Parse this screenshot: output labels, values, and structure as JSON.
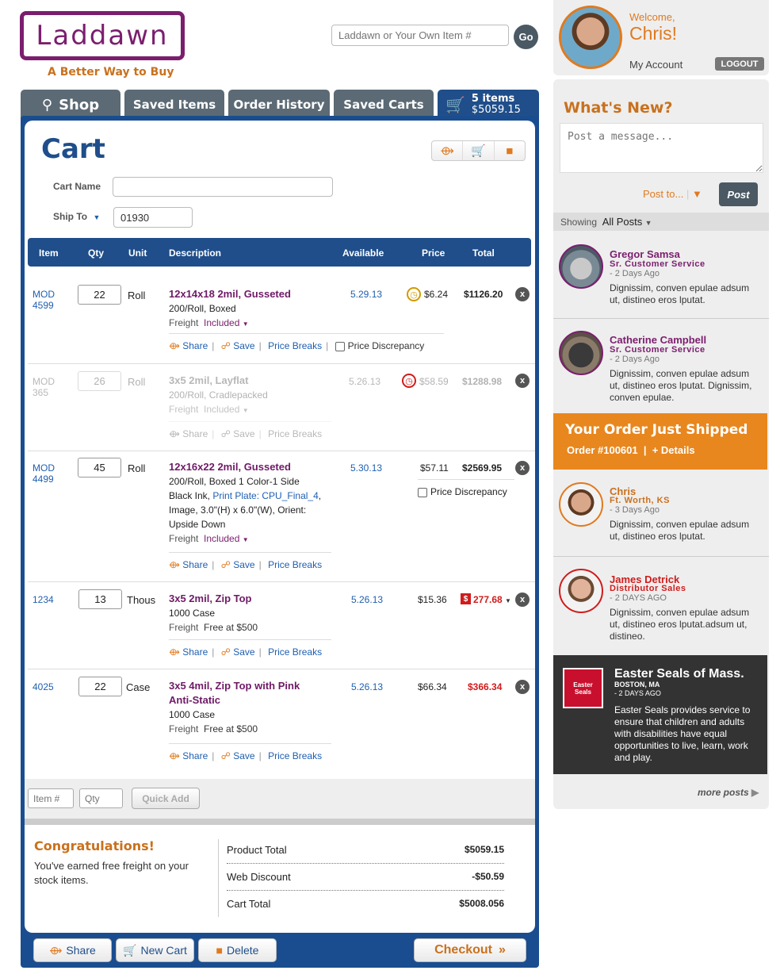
{
  "header": {
    "logo": "Laddawn",
    "tagline": "A Better Way to Buy",
    "search_placeholder": "Laddawn or Your Own Item #",
    "go_label": "Go"
  },
  "tabs": {
    "shop": "Shop",
    "saved_items": "Saved Items",
    "order_history": "Order History",
    "saved_carts": "Saved Carts",
    "cart_items": "5 items",
    "cart_total": "$5059.15"
  },
  "cart": {
    "title": "Cart",
    "cart_name_label": "Cart Name",
    "cart_name_value": "",
    "ship_to_label": "Ship To",
    "ship_to_value": "01930",
    "columns": {
      "item": "Item",
      "qty": "Qty",
      "unit": "Unit",
      "description": "Description",
      "available": "Available",
      "price": "Price",
      "total": "Total"
    },
    "freight_label": "Freight",
    "share": "Share",
    "save": "Save",
    "price_breaks": "Price Breaks",
    "price_discrepancy": "Price Discrepancy",
    "rows": [
      {
        "item1": "MOD",
        "item2": "4599",
        "qty": "22",
        "unit": "Roll",
        "title": "12x14x18 2mil, Gusseted",
        "line1": "200/Roll, Boxed",
        "freight": "Included",
        "available": "5.29.13",
        "price": "$6.24",
        "total": "$1126.20"
      },
      {
        "item1": "MOD",
        "item2": "365",
        "qty": "26",
        "unit": "Roll",
        "title": "3x5 2mil, Layflat",
        "line1": "200/Roll, Cradlepacked",
        "freight": "Included",
        "available": "5.26.13",
        "price": "$58.59",
        "total": "$1288.98"
      },
      {
        "item1": "MOD",
        "item2": "4499",
        "qty": "45",
        "unit": "Roll",
        "title": "12x16x22 2mil, Gusseted",
        "line1": "200/Roll, Boxed  1 Color-1 Side",
        "line2a": "Black Ink, ",
        "line2link": "Print Plate: CPU_Final_4",
        "line2b": ",",
        "line3": "Image, 3.0\"(H) x 6.0\"(W), Orient:",
        "line4": "Upside Down",
        "freight": "Included",
        "available": "5.30.13",
        "price": "$57.11",
        "total": "$2569.95"
      },
      {
        "item1": "1234",
        "qty": "13",
        "unit": "Thous",
        "title": "3x5 2mil, Zip Top",
        "line1": "1000 Case",
        "freight": "Free at $500",
        "available": "5.26.13",
        "price": "$15.36",
        "total": "277.68"
      },
      {
        "item1": "4025",
        "qty": "22",
        "unit": "Case",
        "title": "3x5 4mil, Zip Top with Pink",
        "title2": "Anti-Static",
        "line1": "1000 Case",
        "freight": "Free at $500",
        "available": "5.26.13",
        "price": "$66.34",
        "total": "$366.34"
      }
    ],
    "quick_add": {
      "item_placeholder": "Item #",
      "qty_placeholder": "Qty",
      "button": "Quick Add"
    },
    "congrats_title": "Congratulations!",
    "congrats_text": "You've earned free freight on your stock items.",
    "summary": [
      {
        "label": "Product Total",
        "value": "$5059.15"
      },
      {
        "label": "Web Discount",
        "value": "-$50.59"
      },
      {
        "label": "Cart Total",
        "value": "$5008.056"
      }
    ],
    "footer_buttons": {
      "share": "Share",
      "new_cart": "New Cart",
      "delete": "Delete",
      "checkout": "Checkout"
    }
  },
  "sidebar": {
    "welcome": "Welcome,",
    "user": "Chris!",
    "my_account": "My Account",
    "logout": "LOGOUT",
    "whats_new": "What's New?",
    "post_placeholder": "Post a message...",
    "post_to": "Post to...",
    "post_button": "Post",
    "showing_label": "Showing",
    "showing_value": "All Posts",
    "posts": [
      {
        "name": "Gregor Samsa",
        "role": "Sr. Customer Service",
        "time": "- 2 Days Ago",
        "text": "Dignissim, conven epulae adsum ut, distineo eros lputat."
      },
      {
        "name": "Catherine Campbell",
        "role": "Sr. Customer Service",
        "time": "- 2 Days Ago",
        "text": "Dignissim, conven epulae adsum ut, distineo eros lputat. Dignissim, conven epulae."
      },
      {
        "name": "Chris",
        "role": "Ft. Worth, KS",
        "time": "- 3 Days Ago",
        "text": "Dignissim, conven epulae adsum ut, distineo eros lputat."
      },
      {
        "name": "James Detrick",
        "role": "Distributor Sales",
        "time": "- 2 DAYS AGO",
        "text": "Dignissim, conven epulae adsum ut, distineo eros lputat.adsum ut, distineo."
      }
    ],
    "shipped_title": "Your Order Just Shipped",
    "shipped_order": "Order #100601",
    "shipped_details": "+ Details",
    "easter": {
      "name": "Easter Seals of Mass.",
      "location": "BOSTON, MA",
      "time": "- 2 DAYS AGO",
      "text": "Easter Seals provides service to ensure that children and adults with disabilities have equal opportunities to live, learn, work and play.",
      "logo_text": "Easter Seals"
    },
    "more_posts": "more posts"
  }
}
